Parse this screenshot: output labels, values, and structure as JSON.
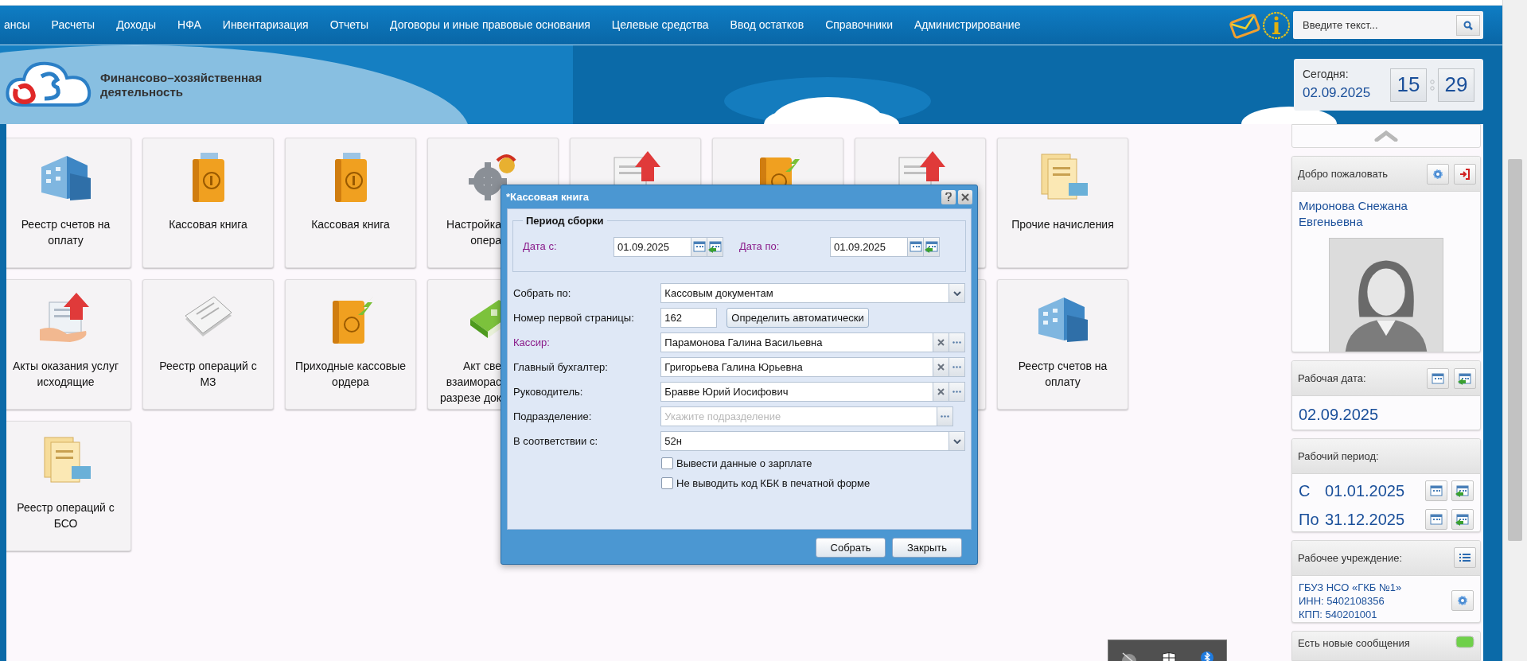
{
  "menu": [
    "ансы",
    "Расчеты",
    "Доходы",
    "НФА",
    "Инвентаризация",
    "Отчеты",
    "Договоры и иные правовые основания",
    "Целевые средства",
    "Ввод остатков",
    "Справочники",
    "Администрирование"
  ],
  "search": {
    "placeholder": "Введите текст..."
  },
  "logo": {
    "lines": [
      "Финансово–хозяйственная",
      "деятельность"
    ]
  },
  "today": {
    "label": "Сегодня:",
    "date": "02.09.2025",
    "hours": "15",
    "minutes": "29"
  },
  "tiles": [
    {
      "kind": "building",
      "lines": [
        "Реестр счетов на",
        "оплату"
      ]
    },
    {
      "kind": "cash-book",
      "lines": [
        "Кассовая книга"
      ]
    },
    {
      "kind": "cash-book",
      "lines": [
        "Кассовая книга"
      ]
    },
    {
      "kind": "gear",
      "lines": [
        "Настройка",
        "опера"
      ],
      "cut": true
    },
    {
      "kind": "doc-arrow"
    },
    {
      "kind": "book-arrow"
    },
    {
      "kind": "doc-arrow"
    },
    {
      "kind": "receipts",
      "lines": [
        "Прочие начисления"
      ]
    },
    {
      "kind": "hand-doc",
      "lines": [
        "Акты оказания услуг",
        "исходящие"
      ]
    },
    {
      "kind": "paper",
      "lines": [
        "Реестр операций с",
        "МЗ"
      ]
    },
    {
      "kind": "book-arrow",
      "lines": [
        "Приходные кассовые",
        "ордера"
      ]
    },
    {
      "kind": "green-book",
      "lines": [
        "Акт све",
        "взаиморас",
        "разрезе док"
      ],
      "cut": true
    },
    {
      "kind": "blank"
    },
    {
      "kind": "building",
      "lines": [
        "Реестр счетов на",
        "оплату"
      ]
    },
    {
      "kind": "receipts",
      "lines": [
        "Реестр операций с",
        "БСО"
      ]
    }
  ],
  "dialog": {
    "title": "*Кассовая книга",
    "period": {
      "legend": "Период сборки",
      "dates": [
        {
          "label": "Дата с:",
          "value": "01.09.2025",
          "required": true
        },
        {
          "label": "Дата по:",
          "value": "01.09.2025",
          "required": true
        }
      ]
    },
    "fields": [
      {
        "kind": "select",
        "label": "Собрать по:",
        "value": "Кассовым документам",
        "required": false
      },
      {
        "kind": "number",
        "label": "Номер первой страницы:",
        "value": "162",
        "button": "Определить автоматически",
        "required": false
      },
      {
        "kind": "lookup",
        "label": "Кассир:",
        "value": "Парамонова Галина Васильевна",
        "required": true
      },
      {
        "kind": "lookup",
        "label": "Главный бухгалтер:",
        "value": "Григорьева Галина Юрьевна",
        "required": false
      },
      {
        "kind": "lookup",
        "label": "Руководитель:",
        "value": "Бравве Юрий Иосифович",
        "required": false
      },
      {
        "kind": "lookup",
        "label": "Подразделение:",
        "placeholder": "Укажите подразделение",
        "required": false
      },
      {
        "kind": "select",
        "label": "В соответствии с:",
        "value": "52н",
        "required": false
      }
    ],
    "options": [
      {
        "label": "Вывести данные о зарплате",
        "checked": false
      },
      {
        "label": "Не выводить код КБК в печатной форме",
        "checked": false
      }
    ],
    "buttons": [
      "Собрать",
      "Закрыть"
    ]
  },
  "sidebar": {
    "welcome": {
      "title": "Добро пожаловать",
      "user": "Миронова Снежана Евгеньевна"
    },
    "work_date": {
      "title": "Рабочая дата:",
      "value": "02.09.2025"
    },
    "work_period": {
      "title": "Рабочий период:",
      "rows": [
        {
          "prefix": "С",
          "date": "01.01.2025"
        },
        {
          "prefix": "По",
          "date": "31.12.2025"
        }
      ]
    },
    "institution": {
      "title": "Рабочее учреждение:",
      "lines": [
        "ГБУЗ НСО «ГКБ №1»",
        "ИНН: 5402108356",
        "КПП: 540201001"
      ]
    },
    "messages": {
      "title": "Есть новые сообщения"
    }
  }
}
